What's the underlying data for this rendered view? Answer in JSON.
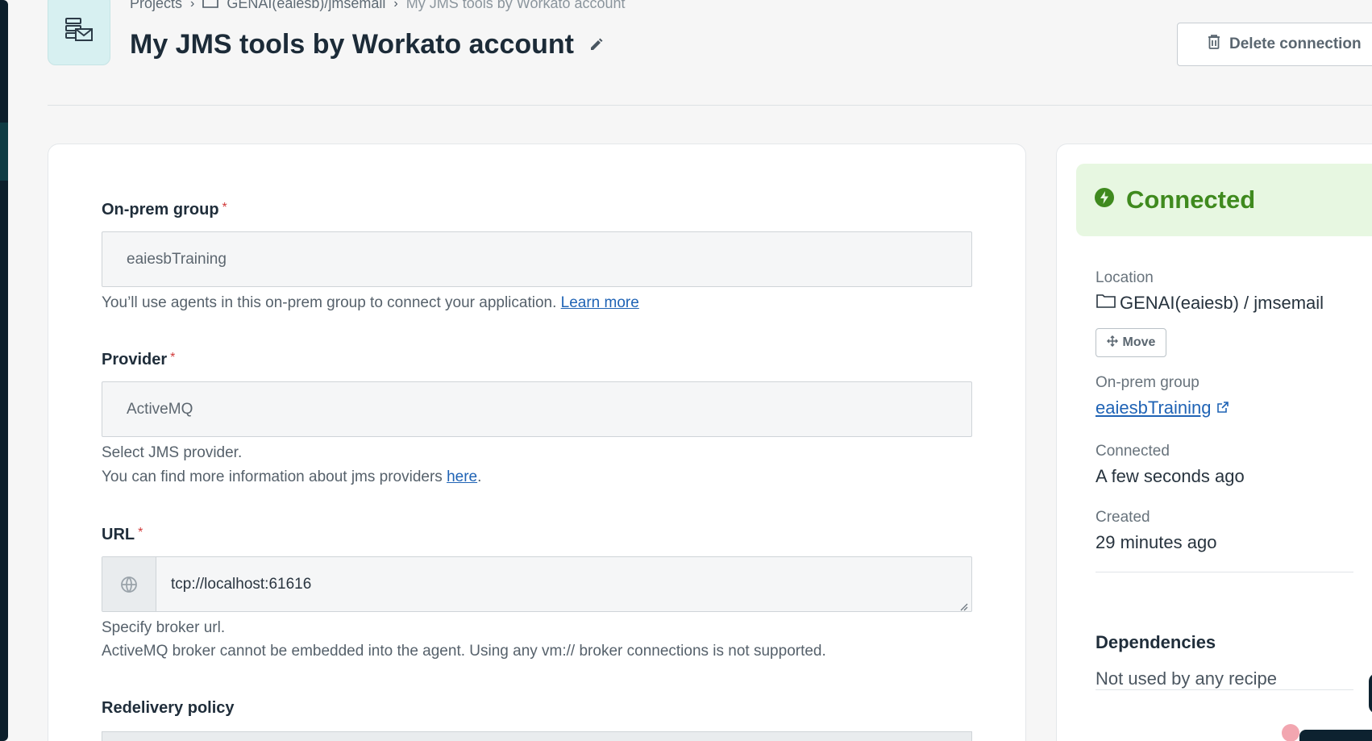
{
  "header": {
    "breadcrumb": {
      "projects": "Projects",
      "folder": "GENAI(eaiesb)/jmsemail",
      "current": "My JMS tools by Workato account"
    },
    "title": "My JMS tools by Workato account",
    "delete_label": "Delete connection"
  },
  "form": {
    "onprem": {
      "label": "On-prem group",
      "required_mark": "*",
      "value": "eaiesbTraining",
      "hint": "You’ll use agents in this on-prem group to connect your application.",
      "hint_link": "Learn more"
    },
    "provider": {
      "label": "Provider",
      "required_mark": "*",
      "value": "ActiveMQ",
      "hint_line1": "Select JMS provider.",
      "hint_line2": "You can find more information about jms providers",
      "hint_link": "here",
      "hint_end": "."
    },
    "url": {
      "label": "URL",
      "required_mark": "*",
      "value": "tcp://localhost:61616",
      "hint_line1": "Specify broker url.",
      "hint_line2": "ActiveMQ broker cannot be embedded into the agent. Using any vm:// broker connections is not supported."
    },
    "redelivery": {
      "label": "Redelivery policy"
    }
  },
  "sidebar": {
    "status": "Connected",
    "location_label": "Location",
    "location_value": "GENAI(eaiesb) / jmsemail",
    "move_label": "Move",
    "onprem_label": "On-prem group",
    "onprem_value": "eaiesbTraining",
    "connected_label": "Connected",
    "connected_value": "A few seconds ago",
    "created_label": "Created",
    "created_value": "29 minutes ago",
    "dependencies_title": "Dependencies",
    "dependencies_value": "Not used by any recipe"
  },
  "colors": {
    "accent_link": "#1f63b5",
    "success": "#3f8a1e",
    "success_bg": "#e7f7e1",
    "icon_tile": "#d7f0f1",
    "required": "#d13b3b"
  },
  "icons": [
    "connection-app-icon",
    "chevron-right-icon",
    "folder-icon",
    "pencil-icon",
    "trash-icon",
    "bolt-icon",
    "move-icon",
    "external-link-icon",
    "globe-icon",
    "resize-grip-icon"
  ]
}
